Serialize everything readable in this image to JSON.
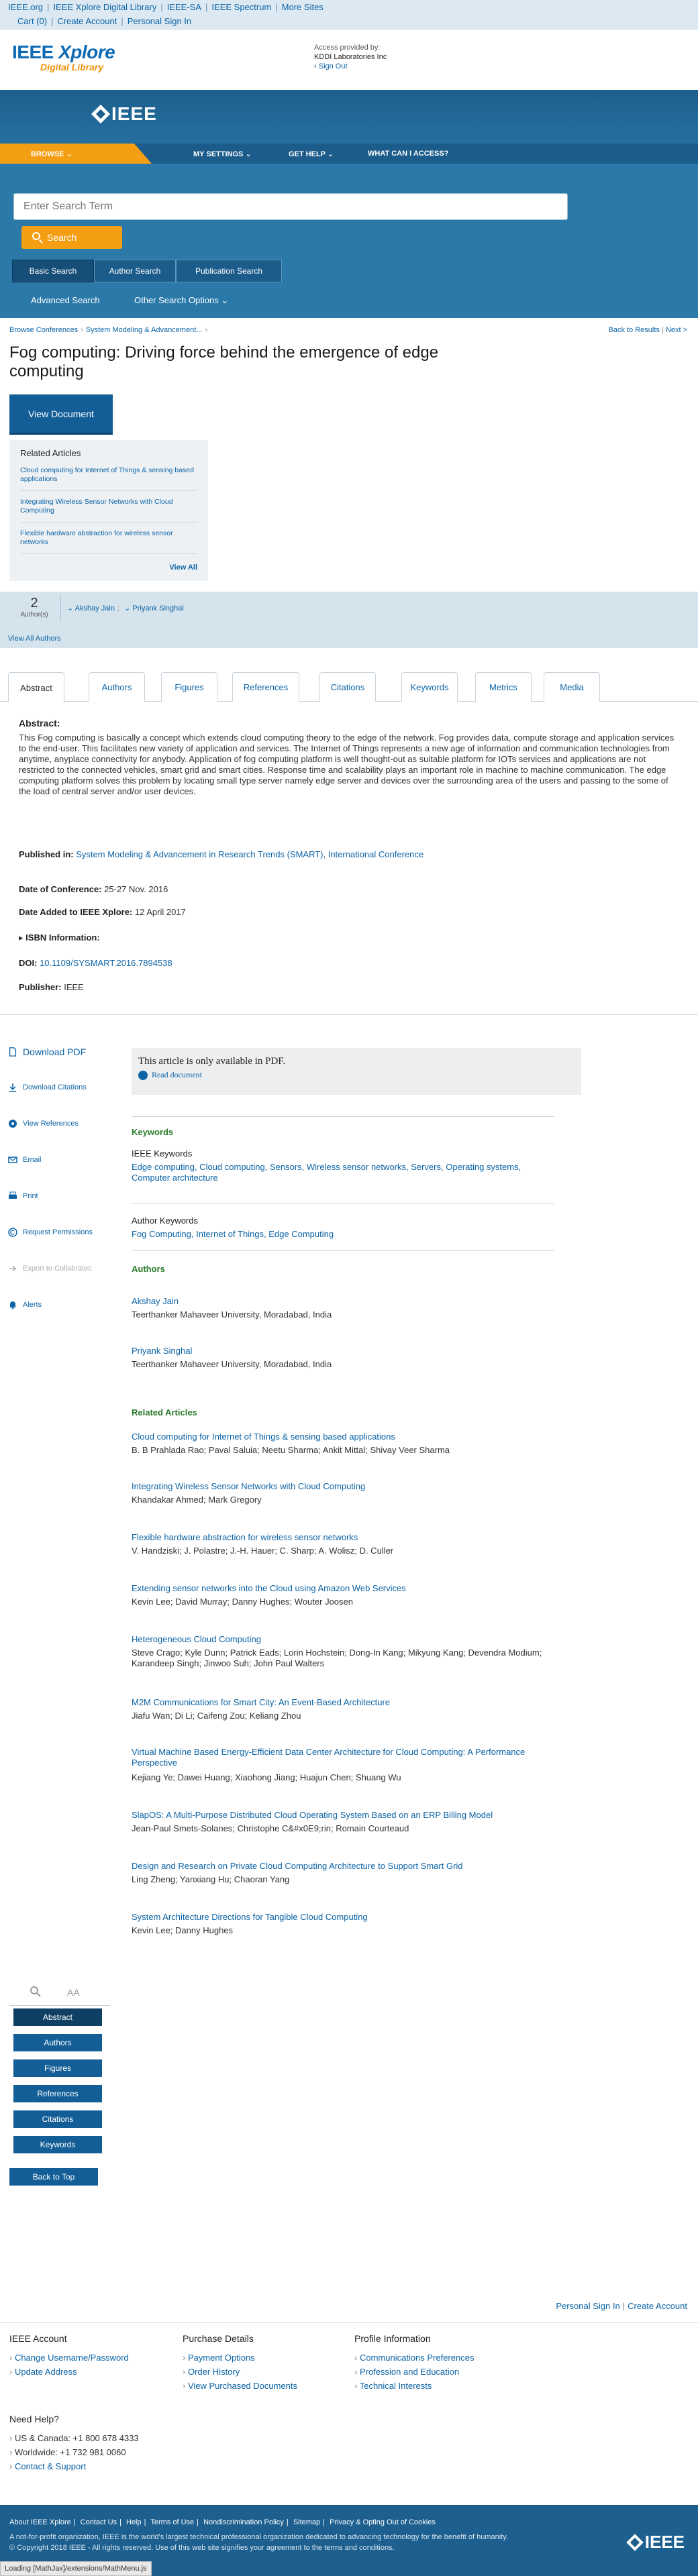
{
  "topbar": {
    "row1": [
      "IEEE.org",
      "IEEE Xplore Digital Library",
      "IEEE-SA",
      "IEEE Spectrum",
      "More Sites"
    ],
    "row2": [
      "Cart (0)",
      "Create Account",
      "Personal Sign In"
    ]
  },
  "brand": {
    "xplore_line1_a": "IEEE ",
    "xplore_line1_b": "Xplore",
    "xplore_line2": "Digital Library",
    "access_label": "Access provided by:",
    "access_org": "KDDI Laboratories Inc",
    "sign_out": "Sign Out",
    "ieee_logo_text": "IEEE"
  },
  "nav": {
    "browse": "BROWSE",
    "my_settings": "MY SETTINGS",
    "get_help": "GET HELP",
    "access": "WHAT CAN I ACCESS?"
  },
  "search": {
    "placeholder": "Enter Search Term",
    "button": "Search",
    "tabs": [
      "Basic Search",
      "Author Search",
      "Publication Search"
    ],
    "advanced": "Advanced Search",
    "other_options": "Other Search Options"
  },
  "breadcrumb": [
    "Browse Conferences",
    "System Modeling & Advancement..."
  ],
  "results_nav": {
    "back": "Back to Results",
    "next": "Next >"
  },
  "document": {
    "title": "Fog computing: Driving force behind the emergence of edge computing",
    "view_button": "View Document"
  },
  "related_box": {
    "heading": "Related Articles",
    "items": [
      "Cloud computing for Internet of Things & sensing based applications",
      "Integrating Wireless Sensor Networks with Cloud Computing",
      "Flexible hardware abstraction for wireless sensor networks"
    ],
    "view_all": "View All"
  },
  "authors_band": {
    "count": "2",
    "count_label": "Author(s)",
    "names": [
      "Akshay Jain",
      "Priyank Singhal"
    ],
    "view_all": "View All Authors"
  },
  "tabs": [
    "Abstract",
    "Authors",
    "Figures",
    "References",
    "Citations",
    "Keywords",
    "Metrics",
    "Media"
  ],
  "abstract": {
    "heading": "Abstract:",
    "text": "This Fog computing is basically a concept which extends cloud computing theory to the edge of the network. Fog provides data, compute storage and application services to the end-user. This facilitates new variety of application and services. The Internet of Things represents a new age of information and communication technologies from anytime, anyplace connectivity for anybody. Application of fog computing platform is well thought-out as suitable platform for IOTs services and applications are not restricted to the connected vehicles, smart grid and smart cities. Response time and scalability plays an important role in machine to machine communication. The edge computing platform solves this problem by locating small type server namely edge server and devices over the surrounding area of the users and passing to the some of the load of central server and/or user devices."
  },
  "meta": {
    "published_label": "Published in:",
    "published_value": "System Modeling & Advancement in Research Trends (SMART), International Conference",
    "conf_date_label": "Date of Conference:",
    "conf_date_value": "25-27 Nov. 2016",
    "added_label": "Date Added to IEEE Xplore:",
    "added_value": "12 April 2017",
    "isbn_label": "ISBN Information:",
    "doi_label": "DOI:",
    "doi_value": "10.1109/SYSMART.2016.7894538",
    "publisher_label": "Publisher:",
    "publisher_value": "IEEE"
  },
  "tools": {
    "download_pdf": "Download PDF",
    "download_citations": "Download Citations",
    "view_references": "View References",
    "email": "Email",
    "print": "Print",
    "request_permissions": "Request Permissions",
    "export": "Export to Collabratec",
    "alerts": "Alerts"
  },
  "pdf_notice": {
    "text": "This article is only available in PDF.",
    "read": "Read document"
  },
  "keywords": {
    "heading": "Keywords",
    "ieee_heading": "IEEE Keywords",
    "ieee_list": "Edge computing, Cloud computing, Sensors, Wireless sensor networks, Servers, Operating systems, Computer architecture",
    "author_heading": "Author Keywords",
    "author_list": "Fog Computing, Internet of Things, Edge Computing"
  },
  "authors_section": {
    "heading": "Authors",
    "list": [
      {
        "name": "Akshay Jain",
        "affiliation": "Teerthanker Mahaveer University, Moradabad, India"
      },
      {
        "name": "Priyank Singhal",
        "affiliation": "Teerthanker Mahaveer University, Moradabad, India"
      }
    ]
  },
  "related_section": {
    "heading": "Related Articles",
    "items": [
      {
        "title": "Cloud computing for Internet of Things & sensing based applications",
        "authors": "B. B Prahlada Rao; Paval Saluia; Neetu Sharma; Ankit Mittal; Shivay Veer Sharma"
      },
      {
        "title": "Integrating Wireless Sensor Networks with Cloud Computing",
        "authors": "Khandakar Ahmed; Mark Gregory"
      },
      {
        "title": "Flexible hardware abstraction for wireless sensor networks",
        "authors": "V. Handziski; J. Polastre; J.-H. Hauer; C. Sharp; A. Wolisz; D. Culler"
      },
      {
        "title": "Extending sensor networks into the Cloud using Amazon Web Services",
        "authors": "Kevin Lee; David Murray; Danny Hughes; Wouter Joosen"
      },
      {
        "title": "Heterogeneous Cloud Computing",
        "authors": "Steve Crago; Kyle Dunn; Patrick Eads; Lorin Hochstein; Dong-In Kang; Mikyung Kang; Devendra Modium; Karandeep Singh; Jinwoo Suh; John Paul Walters"
      },
      {
        "title": "M2M Communications for Smart City: An Event-Based Architecture",
        "authors": "Jiafu Wan; Di Li; Caifeng Zou; Keliang Zhou"
      },
      {
        "title": "Virtual Machine Based Energy-Efficient Data Center Architecture for Cloud Computing: A Performance Perspective",
        "authors": "Kejiang Ye; Dawei Huang; Xiaohong Jiang; Huajun Chen; Shuang Wu"
      },
      {
        "title": "SlapOS: A Multi-Purpose Distributed Cloud Operating System Based on an ERP Billing Model",
        "authors": "Jean-Paul Smets-Solanes; Christophe C&#x0E9;rin; Romain Courteaud"
      },
      {
        "title": "Design and Research on Private Cloud Computing Architecture to Support Smart Grid",
        "authors": "Ling Zheng; Yanxiang Hu; Chaoran Yang"
      },
      {
        "title": "System Architecture Directions for Tangible Cloud Computing",
        "authors": "Kevin Lee; Danny Hughes"
      }
    ]
  },
  "jump_menu": {
    "font_label": "AA",
    "items": [
      "Abstract",
      "Authors",
      "Figures",
      "References",
      "Citations",
      "Keywords",
      "Back to Top"
    ]
  },
  "footer": {
    "top_links": [
      "Personal Sign In",
      "Create Account"
    ],
    "account_heading": "IEEE Account",
    "account_links": [
      "Change Username/Password",
      "Update Address"
    ],
    "purchase_heading": "Purchase Details",
    "purchase_links": [
      "Payment Options",
      "Order History",
      "View Purchased Documents"
    ],
    "profile_heading": "Profile Information",
    "profile_links": [
      "Communications Preferences",
      "Profession and Education",
      "Technical Interests"
    ],
    "help_heading": "Need Help?",
    "help_us": "US & Canada: +1 800 678 4333",
    "help_world": "Worldwide: +1 732 981 0060",
    "help_contact": "Contact & Support",
    "bottom_links": [
      "About IEEE Xplore",
      "Contact Us",
      "Help",
      "Terms of Use",
      "Nondiscrimination Policy",
      "Sitemap",
      "Privacy & Opting Out of Cookies"
    ],
    "bottom_text_1": "A not-for-profit organization, IEEE is the world's largest technical professional organization dedicated to advancing technology for the benefit of humanity.",
    "bottom_text_2": "© Copyright 2018 IEEE - All rights reserved. Use of this web site signifies your agreement to the terms and conditions.",
    "loading": "Loading [MathJax]/extensions/MathMenu.js"
  }
}
